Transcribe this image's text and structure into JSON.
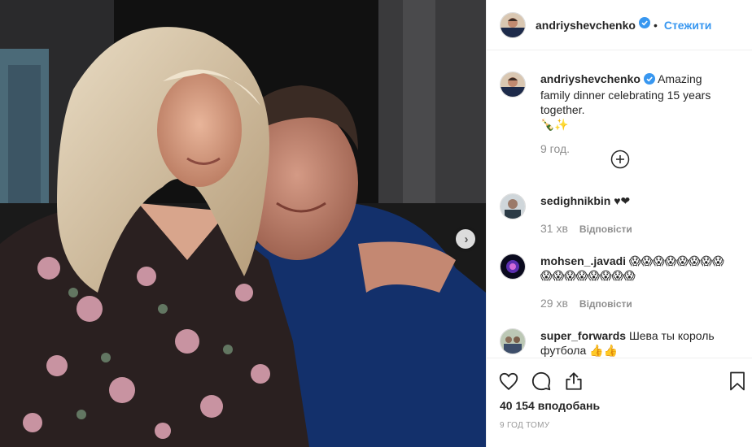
{
  "post": {
    "author": "andriyshevchenko",
    "follow_label": "Стежити",
    "dot": "•",
    "caption_text": "Amazing family dinner celebrating 15 years together.",
    "caption_emoji": "🍾✨",
    "caption_time": "9 год.",
    "likes": "40 154 вподобань",
    "post_time": "9 ГОД ТОМУ"
  },
  "comments": [
    {
      "user": "sedighnikbin",
      "text": "♥❤",
      "time": "31 хв",
      "reply": "Відповісти"
    },
    {
      "user": "mohsen_.javadi",
      "text": "😱😱😱😱😱😱😱😱😱😱😱😱😱😱😱😱",
      "time": "29 хв",
      "reply": "Відповісти"
    },
    {
      "user": "super_forwards",
      "text": "Шева ты король футбола 👍👍",
      "time": "",
      "reply": ""
    }
  ],
  "colors": {
    "accent": "#3897f0",
    "muted": "#8e8e8e",
    "text": "#262626",
    "border": "#efefef"
  },
  "icons": [
    "verified-badge-icon",
    "plus-circle-icon",
    "heart-icon",
    "comment-icon",
    "share-icon",
    "bookmark-icon",
    "chevron-right-icon"
  ]
}
